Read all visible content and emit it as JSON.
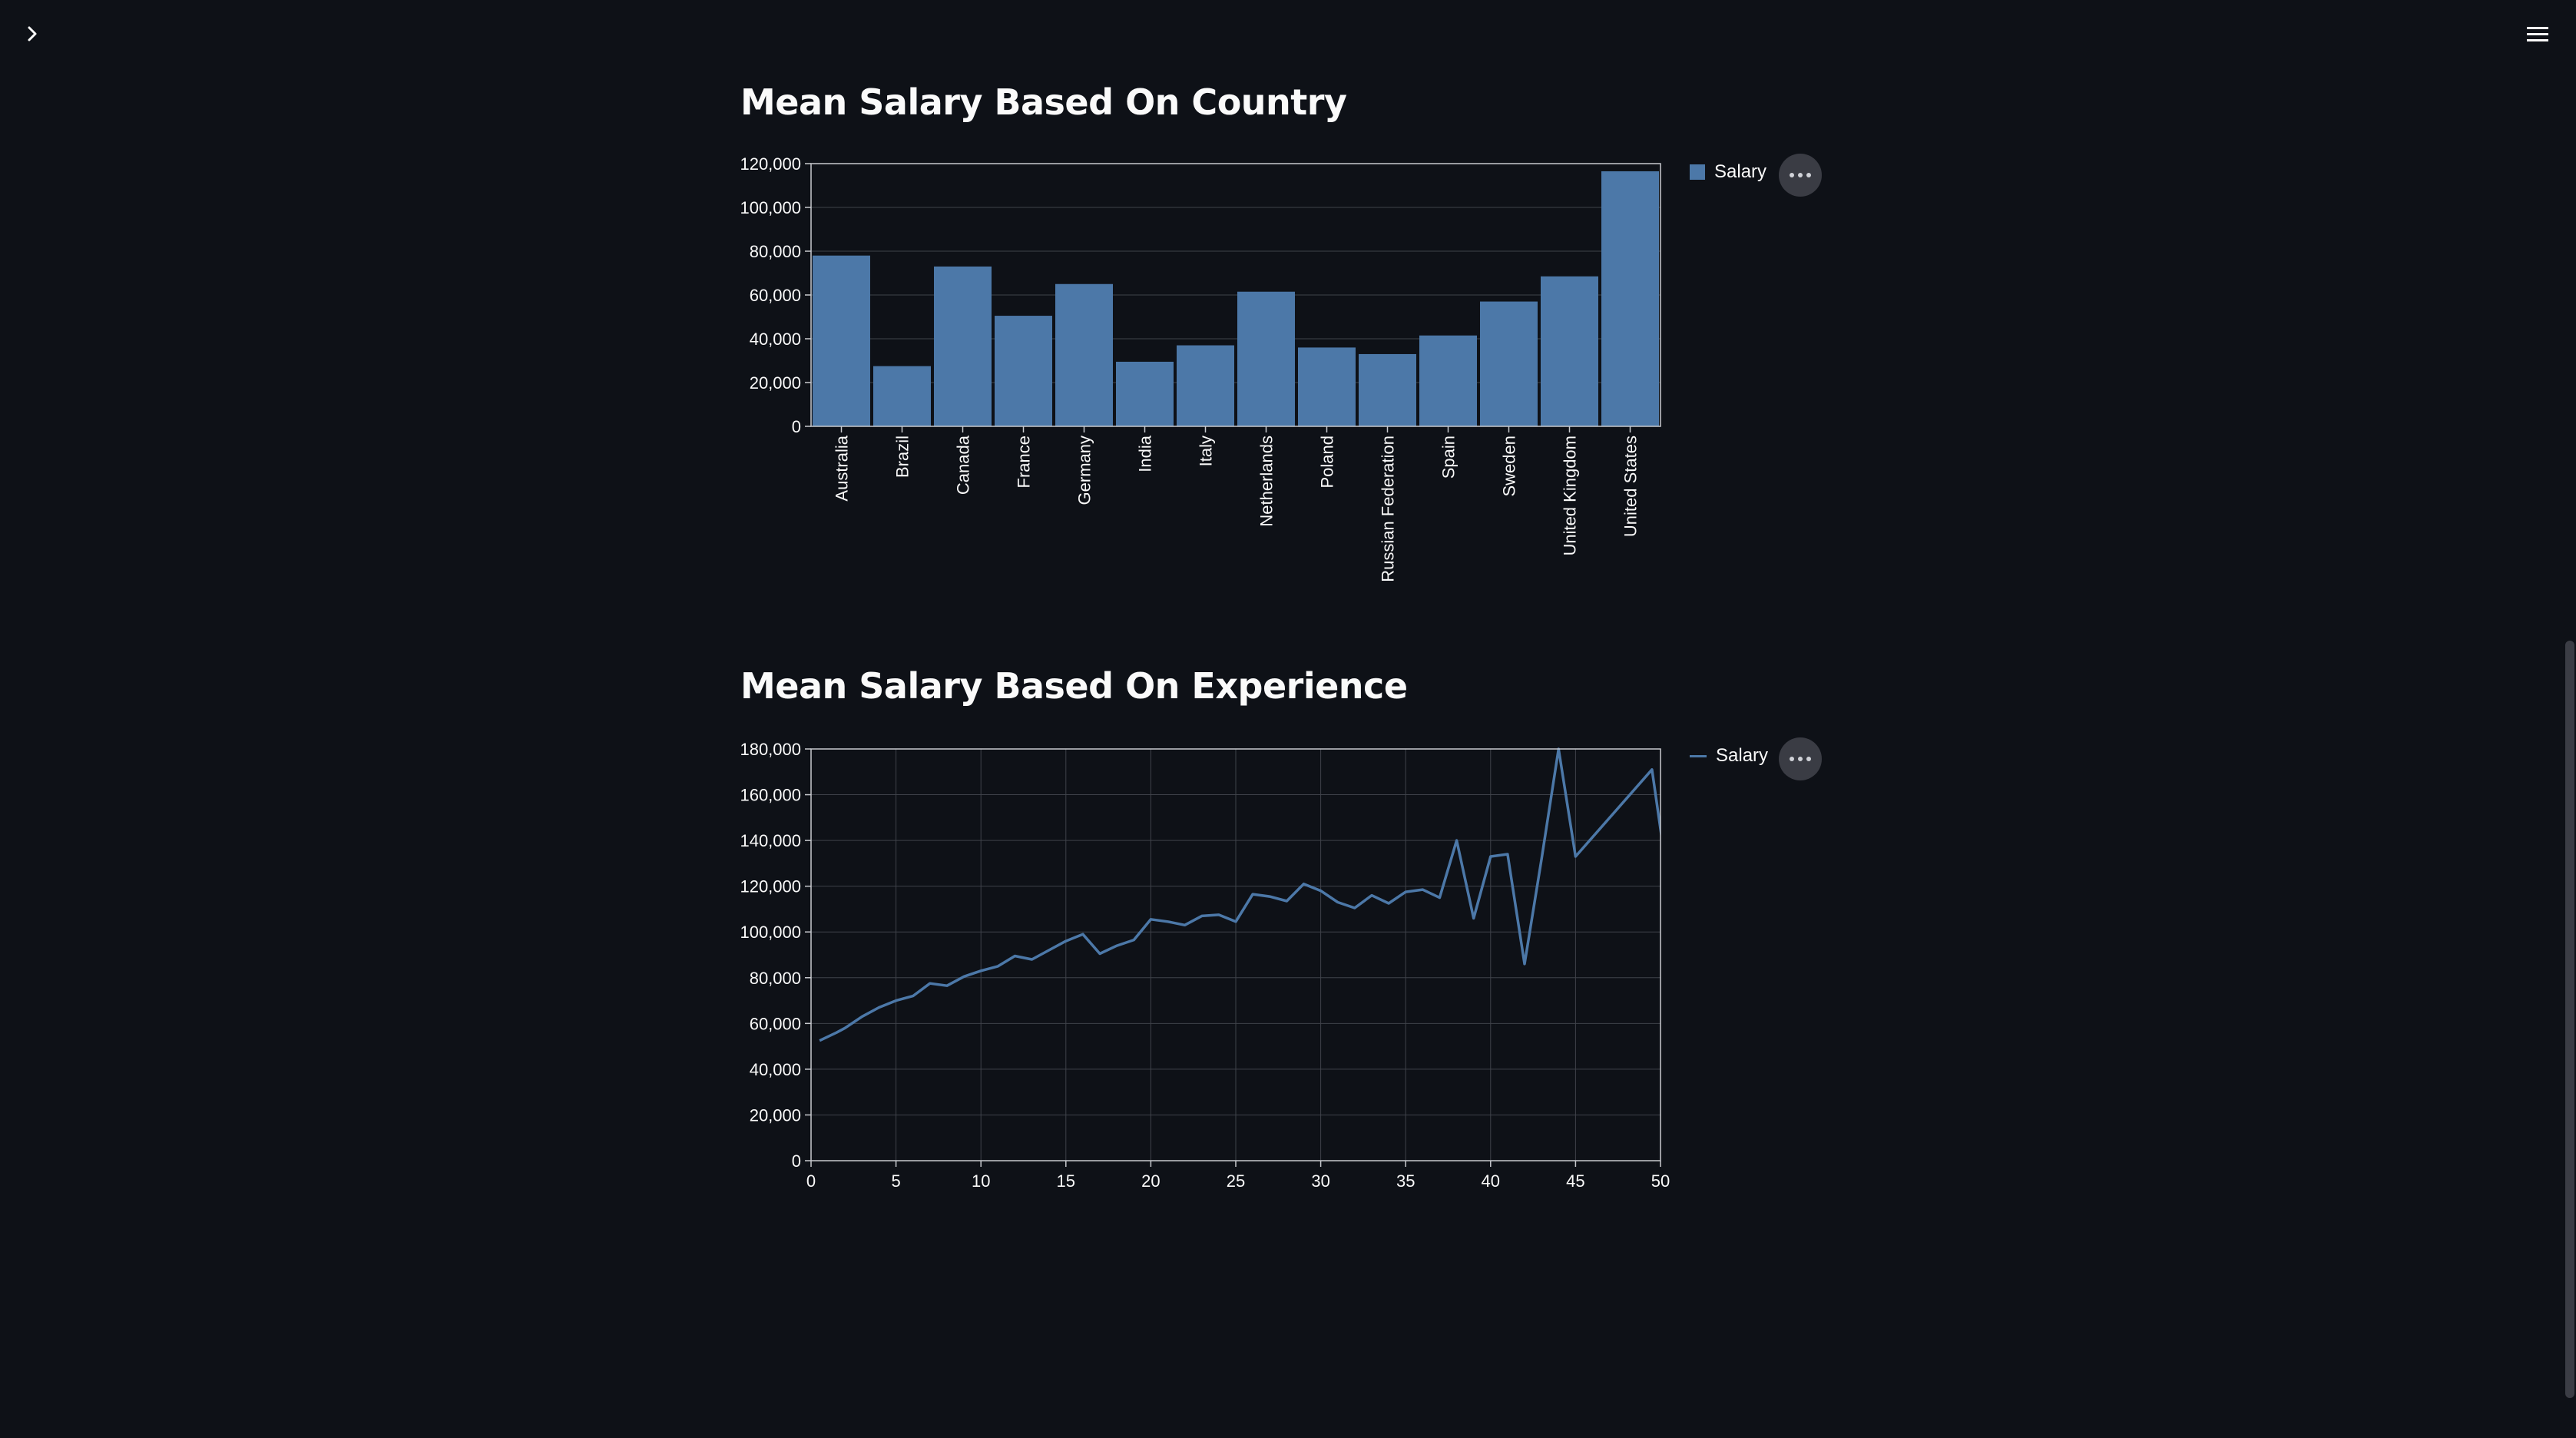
{
  "colors": {
    "background": "#0e1117",
    "series": "#4c78a8",
    "grid": "#3f424a",
    "axis": "#c8cacf",
    "text": "#fafafa"
  },
  "icons": {
    "sidebar_toggle": "chevron-right-icon",
    "main_menu": "hamburger-menu-icon",
    "chart_menu": "ellipsis-icon"
  },
  "sections": {
    "country": {
      "title": "Mean Salary Based On Country"
    },
    "experience": {
      "title": "Mean Salary Based On Experience"
    }
  },
  "chart_data": [
    {
      "type": "bar",
      "title": "Mean Salary Based On Country",
      "xlabel": "",
      "ylabel": "",
      "categories": [
        "Australia",
        "Brazil",
        "Canada",
        "France",
        "Germany",
        "India",
        "Italy",
        "Netherlands",
        "Poland",
        "Russian Federation",
        "Spain",
        "Sweden",
        "United Kingdom",
        "United States"
      ],
      "series": [
        {
          "name": "Salary",
          "values": [
            78000,
            27500,
            73000,
            50500,
            65000,
            29500,
            37000,
            61500,
            36000,
            33000,
            41500,
            57000,
            68500,
            116500
          ]
        }
      ],
      "ylim": [
        0,
        120000
      ],
      "yticks": [
        0,
        20000,
        40000,
        60000,
        80000,
        100000,
        120000
      ],
      "ytick_labels": [
        "0",
        "20,000",
        "40,000",
        "60,000",
        "80,000",
        "100,000",
        "120,000"
      ],
      "grid": "horizontal",
      "legend": "right"
    },
    {
      "type": "line",
      "title": "Mean Salary Based On Experience",
      "xlabel": "",
      "ylabel": "",
      "x": [
        0.5,
        1.5,
        2,
        3,
        4,
        5,
        6,
        7,
        8,
        9,
        10,
        11,
        12,
        13,
        14,
        15,
        16,
        17,
        18,
        19,
        20,
        21,
        22,
        23,
        24,
        25,
        26,
        27,
        28,
        29,
        30,
        31,
        32,
        33,
        34,
        35,
        36,
        37,
        38,
        39,
        40,
        41,
        42,
        43,
        44,
        45,
        49.5,
        50.5
      ],
      "series": [
        {
          "name": "Salary",
          "values": [
            52500,
            56000,
            58000,
            63000,
            67000,
            70000,
            72000,
            77500,
            76500,
            80500,
            83000,
            85000,
            89500,
            88000,
            92000,
            96000,
            99000,
            90500,
            94000,
            96500,
            105500,
            104500,
            103000,
            107000,
            107500,
            104500,
            116500,
            115500,
            113500,
            121000,
            118000,
            113000,
            110500,
            116000,
            112500,
            117500,
            118500,
            115000,
            140000,
            106000,
            133000,
            134000,
            86000,
            132000,
            180000,
            133000,
            171000,
            119000
          ]
        }
      ],
      "xlim": [
        0,
        50
      ],
      "xticks": [
        0,
        5,
        10,
        15,
        20,
        25,
        30,
        35,
        40,
        45,
        50
      ],
      "ylim": [
        0,
        180000
      ],
      "yticks": [
        0,
        20000,
        40000,
        60000,
        80000,
        100000,
        120000,
        140000,
        160000,
        180000
      ],
      "ytick_labels": [
        "0",
        "20,000",
        "40,000",
        "60,000",
        "80,000",
        "100,000",
        "120,000",
        "140,000",
        "160,000",
        "180,000"
      ],
      "grid": "both",
      "legend": "right"
    }
  ]
}
